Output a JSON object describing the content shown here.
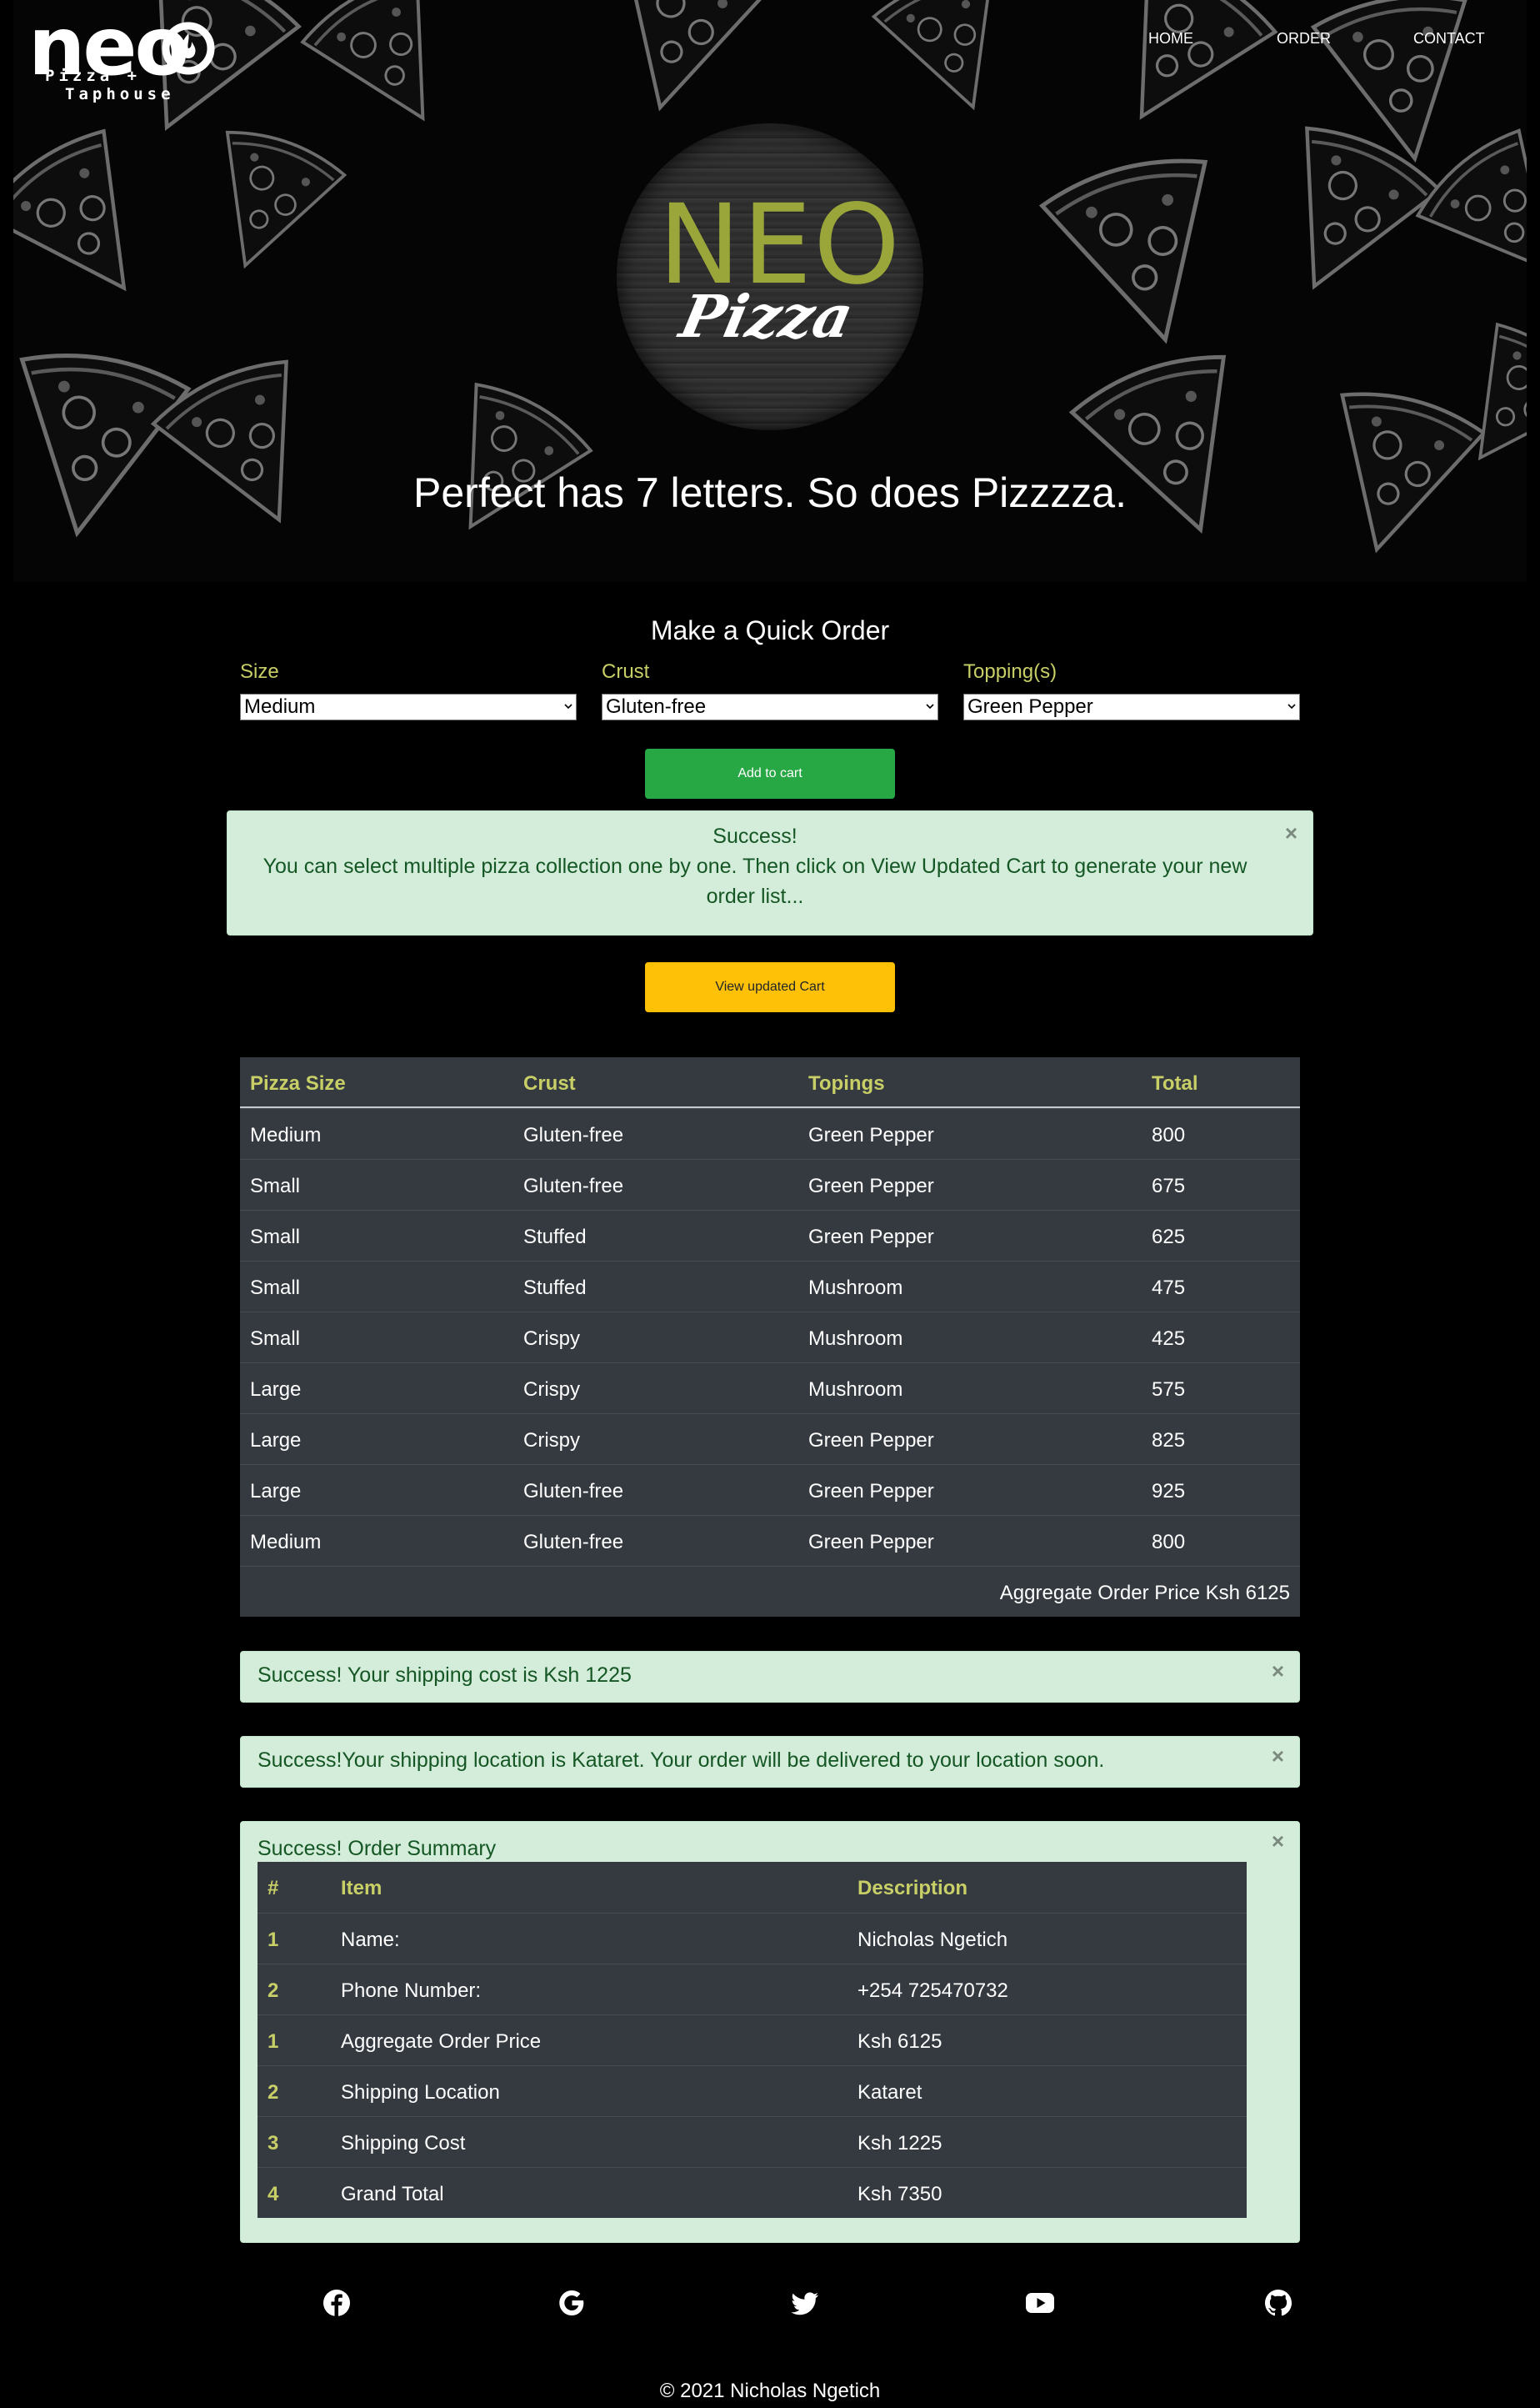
{
  "header": {
    "logo_main": "neo",
    "logo_sub_1": "Pizza +",
    "logo_sub_2": "Taphouse",
    "nav": [
      "HOME",
      "ORDER",
      "CONTACT"
    ]
  },
  "hero": {
    "badge_main": "NEO",
    "badge_sub": "Pizza",
    "tagline": "Perfect has 7 letters. So does Pizzzza."
  },
  "order_form": {
    "title": "Make a Quick Order",
    "size_label": "Size",
    "size_value": "Medium",
    "crust_label": "Crust",
    "crust_value": "Gluten-free",
    "topping_label": "Topping(s)",
    "topping_value": "Green Pepper",
    "add_button": "Add to cart",
    "view_button": "View updated Cart"
  },
  "info_alert": {
    "title": "Success!",
    "message": "You can select multiple pizza collection one by one. Then click on View Updated Cart to generate your new order list...",
    "close": "×"
  },
  "cart": {
    "headers": [
      "Pizza Size",
      "Crust",
      "Topings",
      "Total"
    ],
    "rows": [
      [
        "Medium",
        "Gluten-free",
        "Green Pepper",
        "800"
      ],
      [
        "Small",
        "Gluten-free",
        "Green Pepper",
        "675"
      ],
      [
        "Small",
        "Stuffed",
        "Green Pepper",
        "625"
      ],
      [
        "Small",
        "Stuffed",
        "Mushroom",
        "475"
      ],
      [
        "Small",
        "Crispy",
        "Mushroom",
        "425"
      ],
      [
        "Large",
        "Crispy",
        "Mushroom",
        "575"
      ],
      [
        "Large",
        "Crispy",
        "Green Pepper",
        "825"
      ],
      [
        "Large",
        "Gluten-free",
        "Green Pepper",
        "925"
      ],
      [
        "Medium",
        "Gluten-free",
        "Green Pepper",
        "800"
      ]
    ],
    "aggregate": "Aggregate Order Price Ksh 6125"
  },
  "shipping_cost_alert": {
    "message": "Success! Your shipping cost is Ksh 1225",
    "close": "×"
  },
  "shipping_location_alert": {
    "message": "Success!Your shipping location is Kataret. Your order will be delivered to your location soon.",
    "close": "×"
  },
  "summary": {
    "title": "Success! Order Summary",
    "close": "×",
    "headers": [
      "#",
      "Item",
      "Description"
    ],
    "rows": [
      [
        "1",
        "Name:",
        "Nicholas Ngetich"
      ],
      [
        "2",
        "Phone Number:",
        "+254 725470732"
      ],
      [
        "1",
        "Aggregate Order Price",
        "Ksh 6125"
      ],
      [
        "2",
        "Shipping Location",
        "Kataret"
      ],
      [
        "3",
        "Shipping Cost",
        "Ksh 1225"
      ],
      [
        "4",
        "Grand Total",
        "Ksh 7350"
      ]
    ]
  },
  "social_icons": [
    "facebook-icon",
    "google-icon",
    "twitter-icon",
    "youtube-icon",
    "github-icon"
  ],
  "footer": {
    "copyright": "© 2021 Nicholas Ngetich"
  },
  "colors": {
    "accent_label": "#c8cf66",
    "success_bg": "#d4edda",
    "success_text": "#155724",
    "add_button": "#28a745",
    "view_button": "#ffc107",
    "table_bg": "#343a40"
  }
}
